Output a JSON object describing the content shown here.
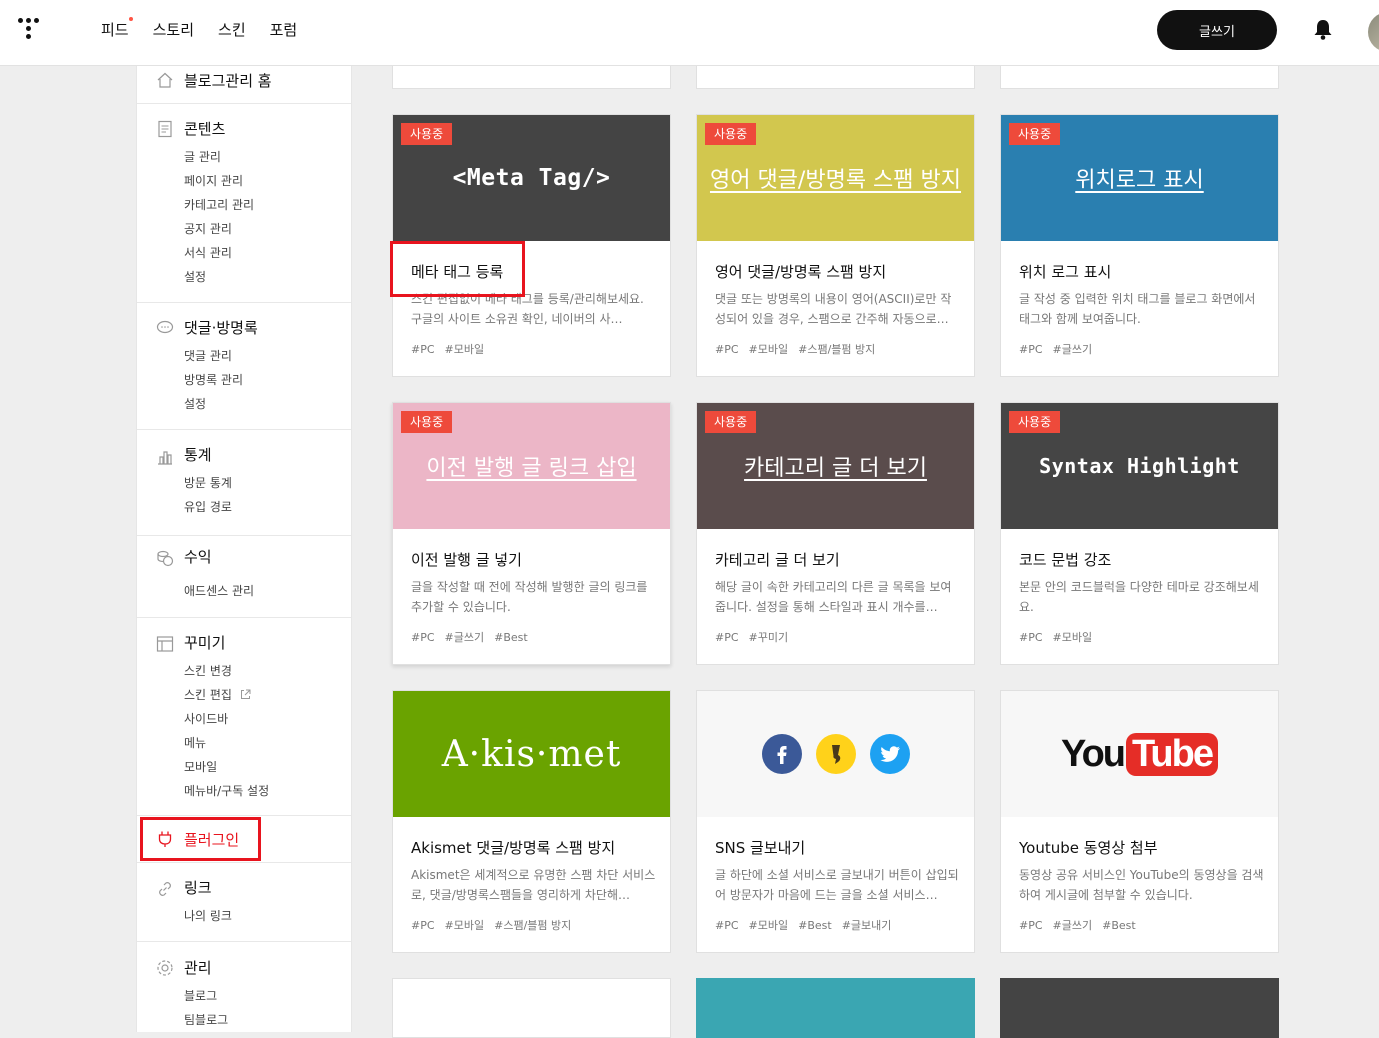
{
  "topnav": {
    "items": [
      "피드",
      "스토리",
      "스킨",
      "포럼"
    ],
    "write_label": "글쓰기"
  },
  "sidebar": {
    "home": "블로그관리 홈",
    "content": {
      "label": "콘텐츠",
      "items": [
        "글 관리",
        "페이지 관리",
        "카테고리 관리",
        "공지 관리",
        "서식 관리",
        "설정"
      ]
    },
    "comments": {
      "label": "댓글·방명록",
      "items": [
        "댓글 관리",
        "방명록 관리",
        "설정"
      ]
    },
    "stats": {
      "label": "통계",
      "items": [
        "방문 통계",
        "유입 경로"
      ]
    },
    "revenue": {
      "label": "수익",
      "items": [
        "애드센스 관리"
      ]
    },
    "decorate": {
      "label": "꾸미기",
      "items": [
        "스킨 변경",
        "스킨 편집",
        "사이드바",
        "메뉴",
        "모바일",
        "메뉴바/구독 설정"
      ]
    },
    "plugins": {
      "label": "플러그인"
    },
    "links": {
      "label": "링크",
      "items": [
        "나의 링크"
      ]
    },
    "manage": {
      "label": "관리",
      "items": [
        "블로그",
        "팀블로그"
      ]
    }
  },
  "badge_label": "사용중",
  "cards": [
    {
      "thumb_text": "<Meta Tag/>",
      "title": "메타 태그 등록",
      "desc": "스킨 편집없이 메타 태그를 등록/관리해보세요. 구글의 사이트 소유권 확인, 네이버의 사…",
      "tags": [
        "#PC",
        "#모바일"
      ],
      "badge": true,
      "thumb_color": "#444444"
    },
    {
      "thumb_text": "영어 댓글/방명록 스팸 방지",
      "title": "영어 댓글/방명록 스팸 방지",
      "desc": "댓글 또는 방명록의 내용이 영어(ASCII)로만 작성되어 있을 경우, 스팸으로 간주해 자동으로…",
      "tags": [
        "#PC",
        "#모바일",
        "#스팸/블펌 방지"
      ],
      "badge": true,
      "thumb_color": "#d2c74e"
    },
    {
      "thumb_text": "위치로그 표시",
      "title": "위치 로그 표시",
      "desc": "글 작성 중 입력한 위치 태그를 블로그 화면에서 태그와 함께 보여줍니다.",
      "tags": [
        "#PC",
        "#글쓰기"
      ],
      "badge": true,
      "thumb_color": "#2a7fb0"
    },
    {
      "thumb_text": "이전 발행 글 링크 삽입",
      "title": "이전 발행 글 넣기",
      "desc": "글을 작성할 때 전에 작성해 발행한 글의 링크를 추가할 수 있습니다.",
      "tags": [
        "#PC",
        "#글쓰기",
        "#Best"
      ],
      "badge": true,
      "thumb_color": "#ecb6c7"
    },
    {
      "thumb_text": "카테고리 글 더 보기",
      "title": "카테고리 글 더 보기",
      "desc": "해당 글이 속한 카테고리의 다른 글 목록을 보여줍니다. 설정을 통해 스타일과 표시 개수를…",
      "tags": [
        "#PC",
        "#꾸미기"
      ],
      "badge": true,
      "thumb_color": "#5a4c4c"
    },
    {
      "thumb_text": "Syntax Highlight",
      "title": "코드 문법 강조",
      "desc": "본문 안의 코드블럭을 다양한 테마로 강조해보세요.",
      "tags": [
        "#PC",
        "#모바일"
      ],
      "badge": true,
      "thumb_color": "#454545"
    },
    {
      "thumb_text": "A·kis·met",
      "title": "Akismet 댓글/방명록 스팸 방지",
      "desc": "Akismet은 세계적으로 유명한 스팸 차단 서비스로, 댓글/방명록스팸들을 영리하게 차단해…",
      "tags": [
        "#PC",
        "#모바일",
        "#스팸/블펌 방지"
      ],
      "badge": false,
      "thumb_color": "#6aa300"
    },
    {
      "thumb_text": "",
      "title": "SNS 글보내기",
      "desc": "글 하단에 소셜 서비스로 글보내기 버튼이 삽입되어 방문자가 마음에 드는 글을 소셜 서비스…",
      "tags": [
        "#PC",
        "#모바일",
        "#Best",
        "#글보내기"
      ],
      "badge": false,
      "thumb_color": "#f7f7f7"
    },
    {
      "thumb_text": "YouTube",
      "title": "Youtube 동영상 첨부",
      "desc": "동영상 공유 서비스인 YouTube의 동영상을 검색하여 게시글에 첨부할 수 있습니다.",
      "tags": [
        "#PC",
        "#글쓰기",
        "#Best"
      ],
      "badge": false,
      "thumb_color": "#f7f7f7"
    }
  ],
  "icons": {
    "topbar": [
      "tistory-logo-icon",
      "bell-icon"
    ],
    "sns": [
      "facebook-icon",
      "kakaostory-icon",
      "twitter-icon"
    ]
  },
  "colors": {
    "badge": "#ee4a3b",
    "highlight": "#e8141e",
    "active_plugin": "#e8141e"
  }
}
